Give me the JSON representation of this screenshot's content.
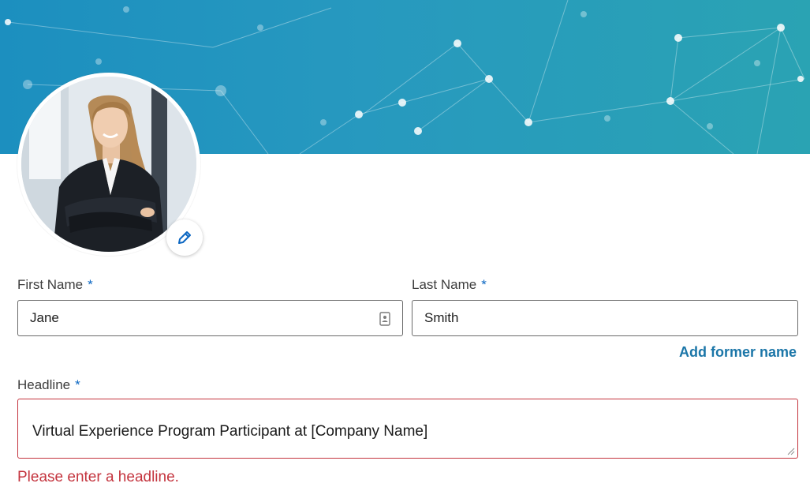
{
  "profile": {
    "edit_photo_icon": "pencil-icon"
  },
  "form": {
    "first_name": {
      "label": "First Name",
      "required_mark": "*",
      "value": "Jane",
      "icon": "contact-card-icon"
    },
    "last_name": {
      "label": "Last Name",
      "required_mark": "*",
      "value": "Smith"
    },
    "add_former_name_label": "Add former name",
    "headline": {
      "label": "Headline",
      "required_mark": "*",
      "value": "Virtual Experience Program Participant at [Company Name]",
      "error": "Please enter a headline."
    }
  },
  "colors": {
    "banner_start": "#1c8fbf",
    "banner_end": "#2aa3b3",
    "required_asterisk": "#0a66c2",
    "link": "#1b76a8",
    "error": "#c4343e"
  }
}
